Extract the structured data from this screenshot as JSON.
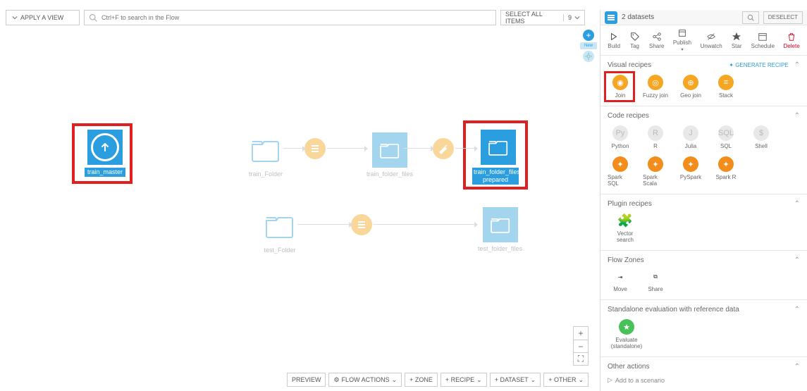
{
  "toolbar": {
    "apply_view": "APPLY A VIEW",
    "search_placeholder": "Ctrl+F to search in the Flow",
    "select_all": "SELECT ALL ITEMS",
    "select_count": "9"
  },
  "nodes": {
    "train_master": "train_master",
    "train_folder": "train_Folder",
    "train_folder_files": "train_folder_files",
    "train_folder_files_prepared": "train_folder_files_\nprepared",
    "test_folder": "test_Folder",
    "test_folder_files": "test_folder_files"
  },
  "right": {
    "header_title": "2 datasets",
    "deselect": "DESELECT",
    "actions": {
      "build": "Build",
      "tag": "Tag",
      "share": "Share",
      "publish": "Publish",
      "unwatch": "Unwatch",
      "star": "Star",
      "schedule": "Schedule",
      "delete": "Delete"
    },
    "visual_recipes": {
      "title": "Visual recipes",
      "generate": "GENERATE RECIPE",
      "join": "Join",
      "fuzzy": "Fuzzy join",
      "geo": "Geo join",
      "stack": "Stack"
    },
    "code_recipes": {
      "title": "Code recipes",
      "python": "Python",
      "r": "R",
      "julia": "Julia",
      "sql": "SQL",
      "shell": "Shell",
      "sparksql": "Spark SQL",
      "sparkscala": "Spark Scala",
      "pyspark": "PySpark",
      "sparkr": "Spark R"
    },
    "plugin": {
      "title": "Plugin recipes",
      "vector": "Vector\nsearch"
    },
    "zones": {
      "title": "Flow Zones",
      "move": "Move",
      "share": "Share"
    },
    "standalone": {
      "title": "Standalone evaluation with reference data",
      "evaluate": "Evaluate\n(standalone)"
    },
    "other": {
      "title": "Other actions",
      "add_scenario": "Add to a scenario"
    }
  },
  "bottom": {
    "preview": "PREVIEW",
    "flow_actions": "FLOW ACTIONS",
    "zone": "+ ZONE",
    "recipe": "+ RECIPE",
    "dataset": "+ DATASET",
    "other": "+ OTHER"
  }
}
